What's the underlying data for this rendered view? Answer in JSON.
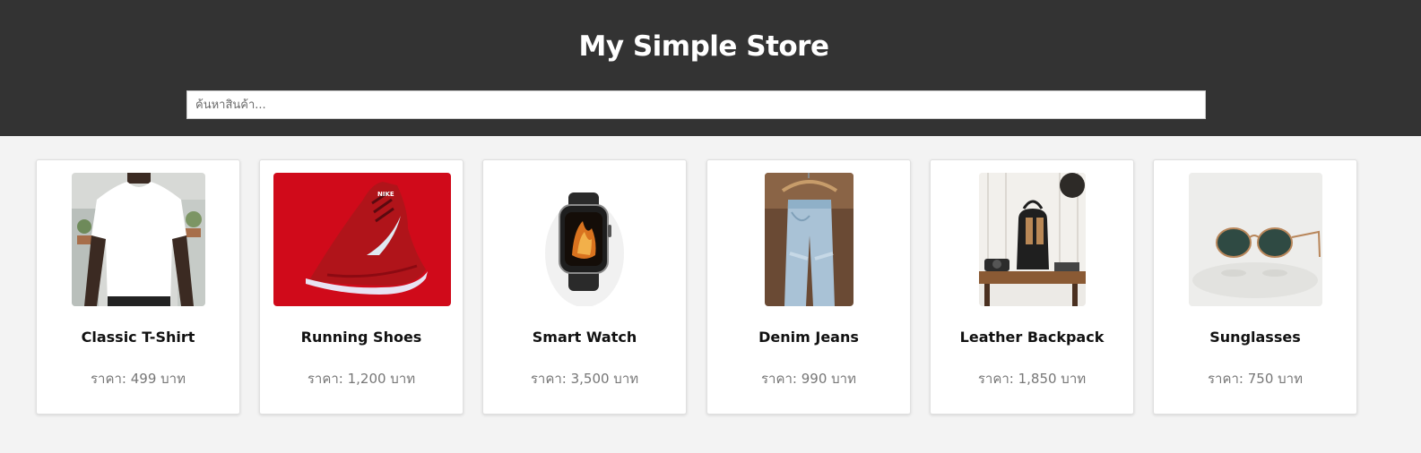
{
  "header": {
    "title": "My Simple Store",
    "search_placeholder": "ค้นหาสินค้า..."
  },
  "colors": {
    "header_bg": "#333333",
    "page_bg": "#f3f3f3",
    "card_bg": "#ffffff",
    "price_text": "#777777"
  },
  "products": [
    {
      "name": "Classic T-Shirt",
      "price": "ราคา: 499 บาท",
      "icon": "tshirt-image"
    },
    {
      "name": "Running Shoes",
      "price": "ราคา: 1,200 บาท",
      "icon": "shoe-image"
    },
    {
      "name": "Smart Watch",
      "price": "ราคา: 3,500 บาท",
      "icon": "watch-image"
    },
    {
      "name": "Denim Jeans",
      "price": "ราคา: 990 บาท",
      "icon": "jeans-image"
    },
    {
      "name": "Leather Backpack",
      "price": "ราคา: 1,850 บาท",
      "icon": "backpack-image"
    },
    {
      "name": "Sunglasses",
      "price": "ราคา: 750 บาท",
      "icon": "sunglasses-image"
    }
  ]
}
